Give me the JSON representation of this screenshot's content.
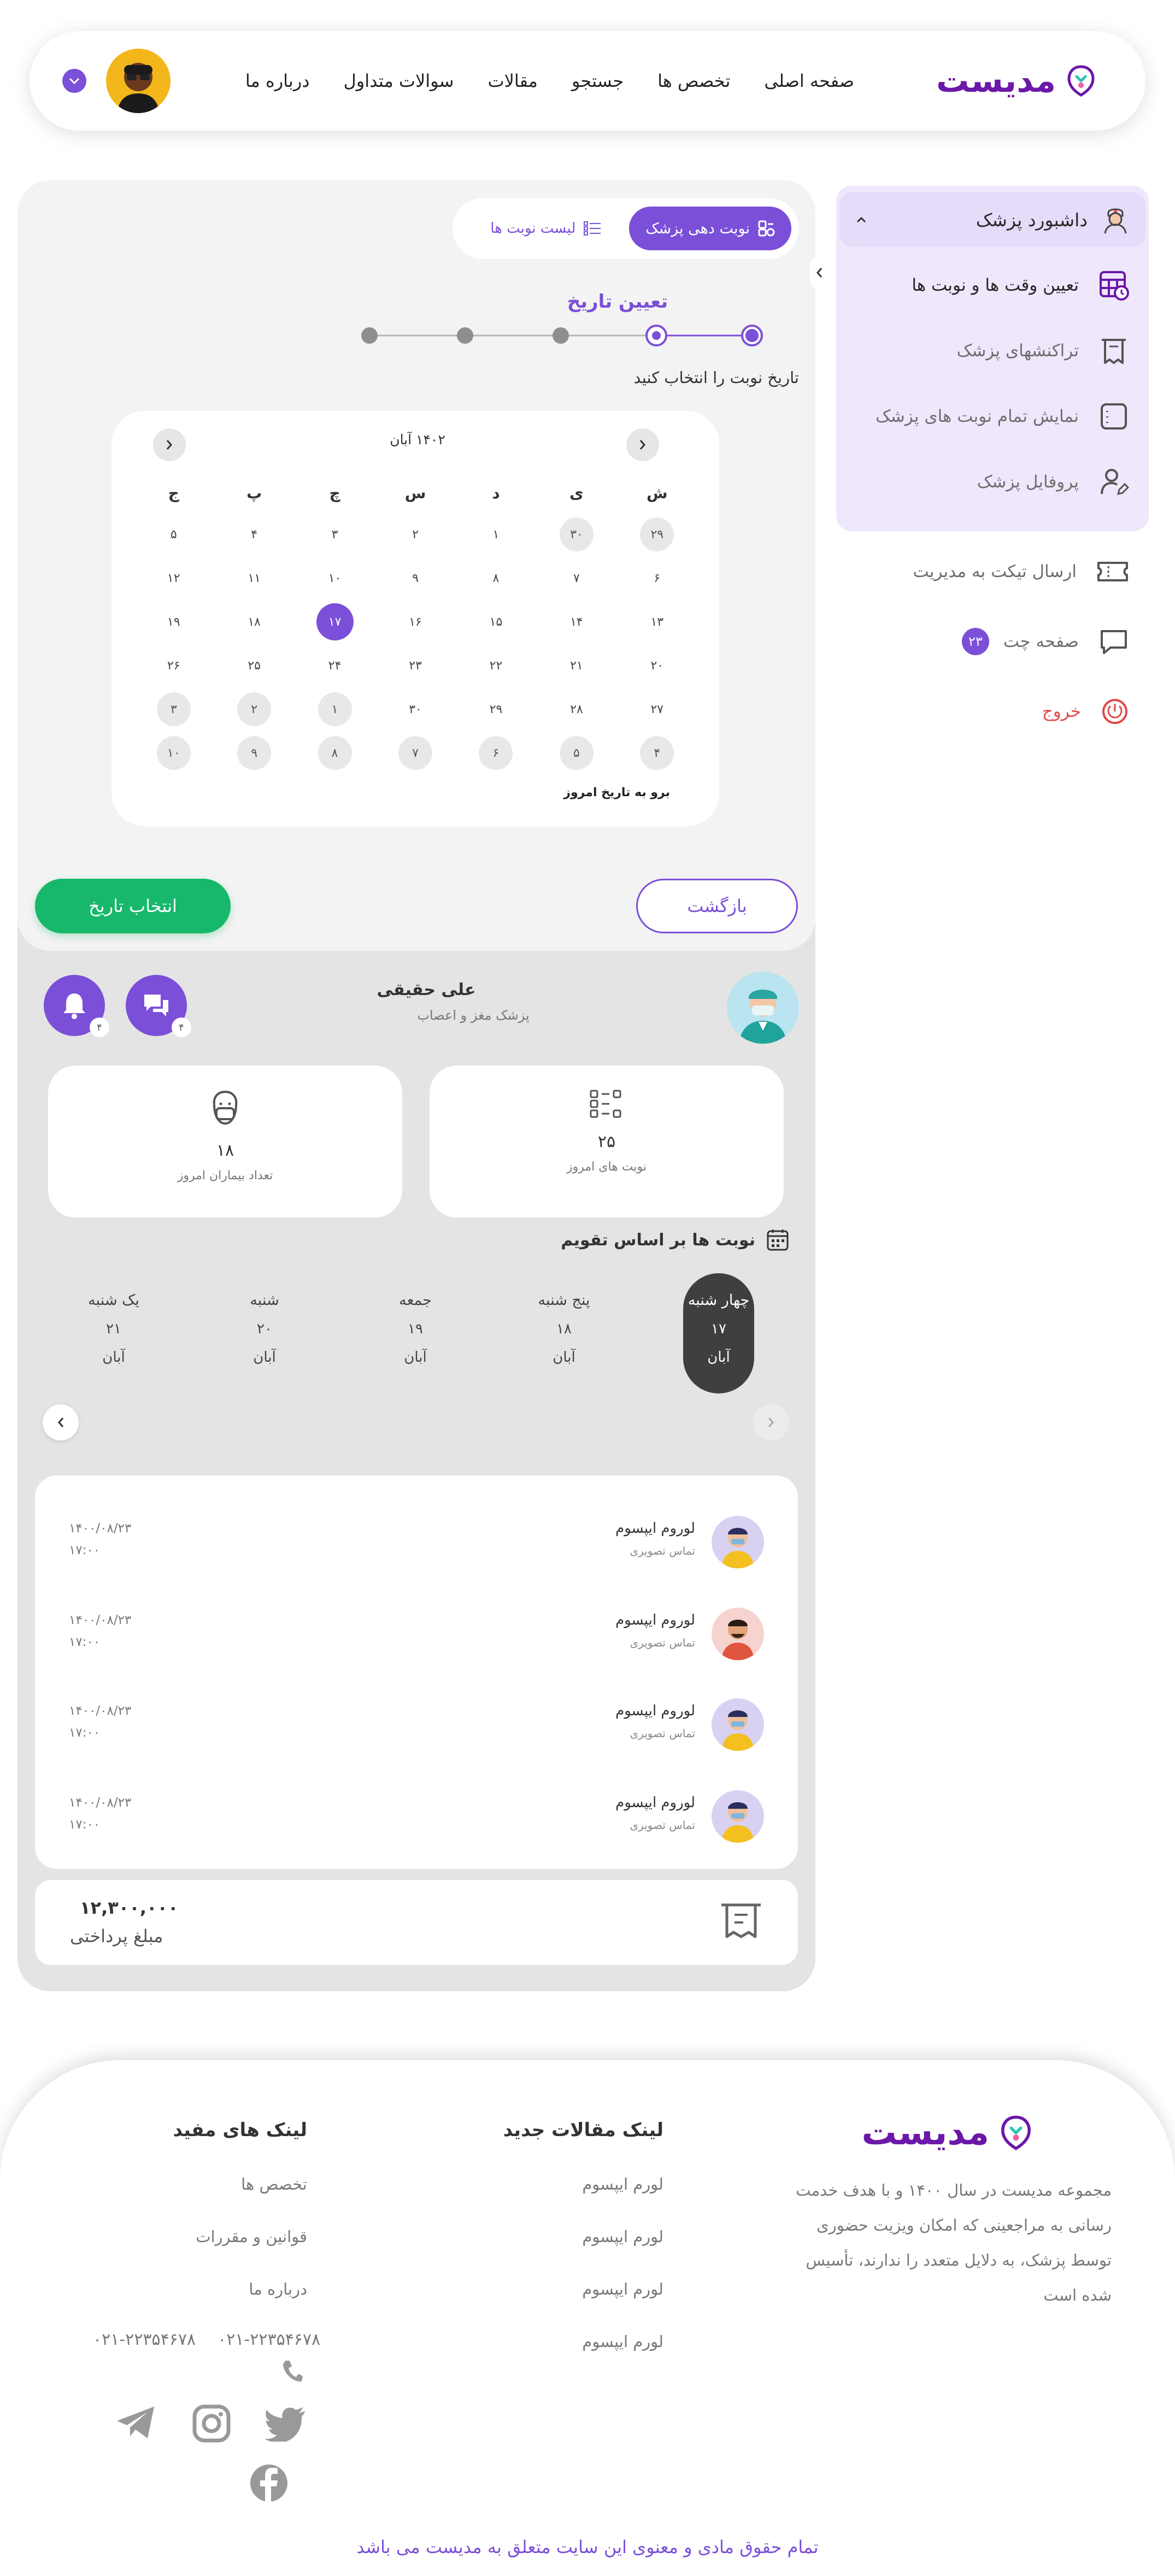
{
  "header": {
    "logo": "مدیست",
    "nav": [
      "صفحه اصلی",
      "تخصص ها",
      "جستجو",
      "مقالات",
      "سوالات متداول",
      "درباره ما"
    ]
  },
  "sidebar": {
    "group_title": "داشبورد پزشک",
    "items": [
      "تعیین وقت ها و نوبت ها",
      "تراکنشهای پزشک",
      "نمایش تمام نوبت های پزشک",
      "پروفایل پزشک"
    ],
    "ticket": "ارسال تیکت به مدیریت",
    "chat": "صفحه چت",
    "chat_badge": "۲۳",
    "logout": "خروج"
  },
  "tabs": {
    "active": "نوبت دهی پزشک",
    "list": "لیست نوبت ها"
  },
  "steps": {
    "title": "تعیین تاریخ",
    "subtitle": "تاریخ نوبت را انتخاب کنید",
    "count": 5,
    "current": 2
  },
  "calendar": {
    "month": "۱۴۰۲ آبان",
    "weekdays": [
      "ش",
      "ی",
      "د",
      "س",
      "چ",
      "پ",
      "ج"
    ],
    "weeks": [
      [
        "۲۹",
        "۳۰",
        "۱",
        "۲",
        "۳",
        "۴",
        "۵"
      ],
      [
        "۶",
        "۷",
        "۸",
        "۹",
        "۱۰",
        "۱۱",
        "۱۲"
      ],
      [
        "۱۳",
        "۱۴",
        "۱۵",
        "۱۶",
        "۱۷",
        "۱۸",
        "۱۹"
      ],
      [
        "۲۰",
        "۲۱",
        "۲۲",
        "۲۳",
        "۲۴",
        "۲۵",
        "۲۶"
      ],
      [
        "۲۷",
        "۲۸",
        "۲۹",
        "۳۰",
        "۱",
        "۲",
        "۳"
      ],
      [
        "۴",
        "۵",
        "۶",
        "۷",
        "۸",
        "۹",
        "۱۰"
      ]
    ],
    "other_month": [
      [
        0,
        0
      ],
      [
        0,
        1
      ],
      [
        4,
        4
      ],
      [
        4,
        5
      ],
      [
        4,
        6
      ],
      [
        5,
        0
      ],
      [
        5,
        1
      ],
      [
        5,
        2
      ],
      [
        5,
        3
      ],
      [
        5,
        4
      ],
      [
        5,
        5
      ],
      [
        5,
        6
      ]
    ],
    "selected": [
      2,
      4
    ],
    "today_link": "برو به تاریخ امروز"
  },
  "buttons": {
    "back": "بازگشت",
    "select": "انتخاب تاریخ"
  },
  "doctor": {
    "name": "علی حقیقی",
    "specialty": "پزشک مغز و اعصاب",
    "notifications": "۴",
    "messages": "۴"
  },
  "stats": [
    {
      "value": "۲۵",
      "label": "نوبت های امروز"
    },
    {
      "value": "۱۸",
      "label": "تعداد بیماران امروز"
    }
  ],
  "schedule": {
    "title": "نوبت ها بر اساس تقویم",
    "days": [
      {
        "name": "چهار شنبه",
        "day": "۱۷",
        "month": "آبان"
      },
      {
        "name": "پنج شنبه",
        "day": "۱۸",
        "month": "آبان"
      },
      {
        "name": "جمعه",
        "day": "۱۹",
        "month": "آبان"
      },
      {
        "name": "شنبه",
        "day": "۲۰",
        "month": "آبان"
      },
      {
        "name": "یک شنبه",
        "day": "۲۱",
        "month": "آبان"
      }
    ]
  },
  "appointments": [
    {
      "name": "لوروم ایپسوم",
      "sub": "تماس تصویری",
      "date": "۱۴۰۰/۰۸/۲۳",
      "time": "۱۷:۰۰"
    },
    {
      "name": "لوروم ایپسوم",
      "sub": "تماس تصویری",
      "date": "۱۴۰۰/۰۸/۲۳",
      "time": "۱۷:۰۰"
    },
    {
      "name": "لوروم ایپسوم",
      "sub": "تماس تصویری",
      "date": "۱۴۰۰/۰۸/۲۳",
      "time": "۱۷:۰۰"
    },
    {
      "name": "لوروم ایپسوم",
      "sub": "تماس تصویری",
      "date": "۱۴۰۰/۰۸/۲۳",
      "time": "۱۷:۰۰"
    }
  ],
  "payment": {
    "amount": "۱۲,۳۰۰,۰۰۰",
    "label": "مبلغ پرداختی"
  },
  "footer": {
    "logo": "مدیست",
    "about": "مجموعه مدیست در سال ۱۴۰۰ و با هدف خدمت رسانی به مراجعینی که امکان ویزیت حضوری توسط پزشک، به دلایل متعدد را ندارند، تأسیس شده است",
    "articles_title": "لینک مقالات جدید",
    "articles": [
      "لورم ایپسوم",
      "لورم ایپسوم",
      "لورم ایپسوم",
      "لورم ایپسوم"
    ],
    "useful_title": "لینک های مفید",
    "useful": [
      "تخصص ها",
      "قوانین و مقررات",
      "درباره ما"
    ],
    "phones": [
      "۰۲۱-۲۲۳۵۴۶۷۸",
      "۰۲۱-۲۲۳۵۴۶۷۸"
    ],
    "copyright": "تمام حقوق مادی و معنوی این سایت متعلق به مدیست می باشد"
  },
  "colors": {
    "accent": "#7b4fd8",
    "brand": "#6b18a8",
    "success": "#17b86b",
    "danger": "#e04a4a"
  }
}
